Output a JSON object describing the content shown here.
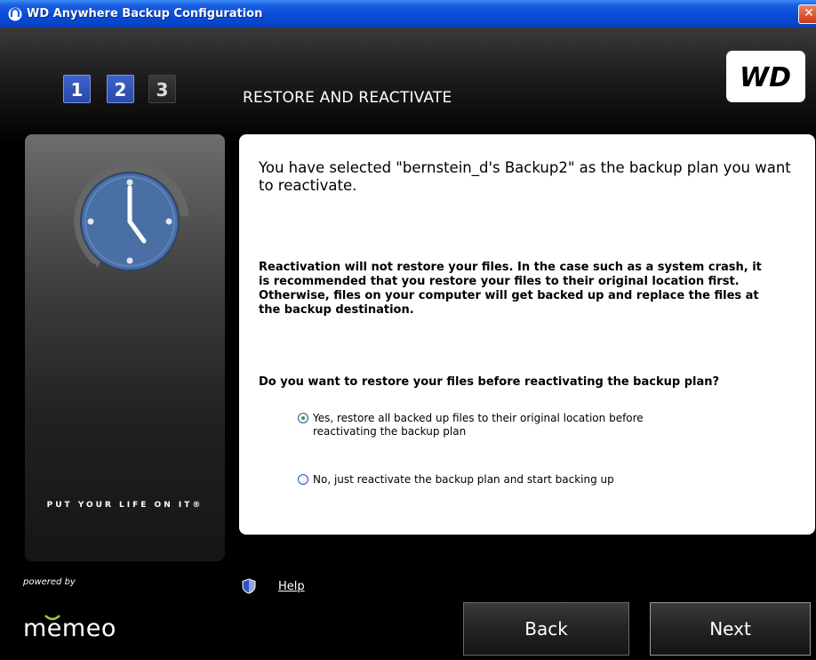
{
  "window": {
    "title": "WD Anywhere Backup Configuration",
    "close_glyph": "✕"
  },
  "header": {
    "steps": [
      "1",
      "2",
      "3"
    ],
    "active_steps": [
      1,
      2
    ],
    "section_title": "RESTORE AND REACTIVATE",
    "logo_text": "WD"
  },
  "side_panel": {
    "tagline": "PUT YOUR LIFE ON IT®",
    "illustration": "clock-icon"
  },
  "content": {
    "lead": "You have selected \"bernstein_d's Backup2\" as the backup plan you want to reactivate.",
    "paragraph": "Reactivation will not restore your files.  In the case such as a system crash, it is recommended that you restore your files to their original location first.  Otherwise, files on your computer will get backed up and replace the files at the backup destination.",
    "question": "Do you want to restore your files before reactivating the backup plan?",
    "options": [
      {
        "label": "Yes, restore all backed up files to their original location before reactivating the backup plan",
        "selected": true
      },
      {
        "label": "No, just reactivate the backup plan and start backing up",
        "selected": false
      }
    ]
  },
  "footer": {
    "powered_by": "powered by",
    "brand": "memeo",
    "help_label": "Help",
    "back_label": "Back",
    "next_label": "Next"
  },
  "colors": {
    "titlebar": "#0a4ed8",
    "step_active": "#3d63c9",
    "radio_selected_dot": "#2fa23a",
    "clock_face": "#4a6fa5"
  }
}
